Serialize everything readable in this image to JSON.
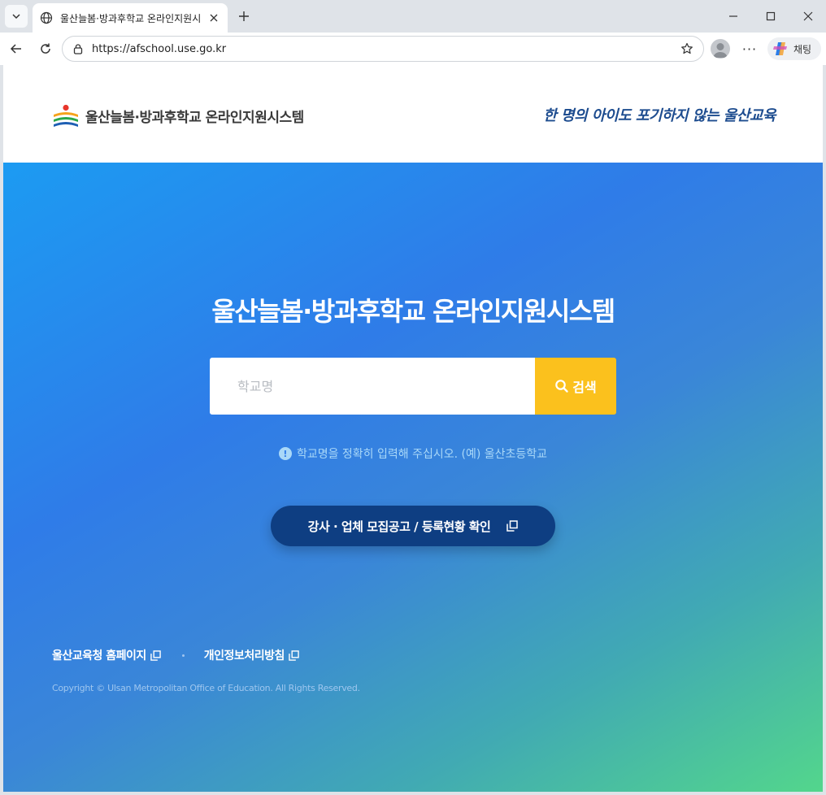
{
  "browser": {
    "tab_title": "울산늘봄·방과후학교 온라인지원시",
    "url": "https://afschool.use.go.kr",
    "copilot_label": "채팅",
    "more_label": "···"
  },
  "header": {
    "site_name": "울산늘봄·방과후학교 온라인지원시스템",
    "slogan": "한 명의 아이도 포기하지 않는 울산교육"
  },
  "hero": {
    "title": "울산늘봄·방과후학교 온라인지원시스템",
    "search_placeholder": "학교명",
    "search_button": "검색",
    "hint_icon": "!",
    "hint": "학교명을 정확히 입력해 주십시오. (예) 울산초등학교",
    "notice_button": "강사 · 업체 모집공고 / 등록현황 확인"
  },
  "footer": {
    "links": [
      "울산교육청 홈페이지",
      "개인정보처리방침"
    ],
    "copyright": "Copyright © Ulsan Metropolitan Office of Education. All Rights Reserved."
  },
  "colors": {
    "accent_yellow": "#fbc11d",
    "notice_navy": "#0e3e82",
    "gradient_start": "#1c9bf2",
    "gradient_end": "#53d68c"
  }
}
